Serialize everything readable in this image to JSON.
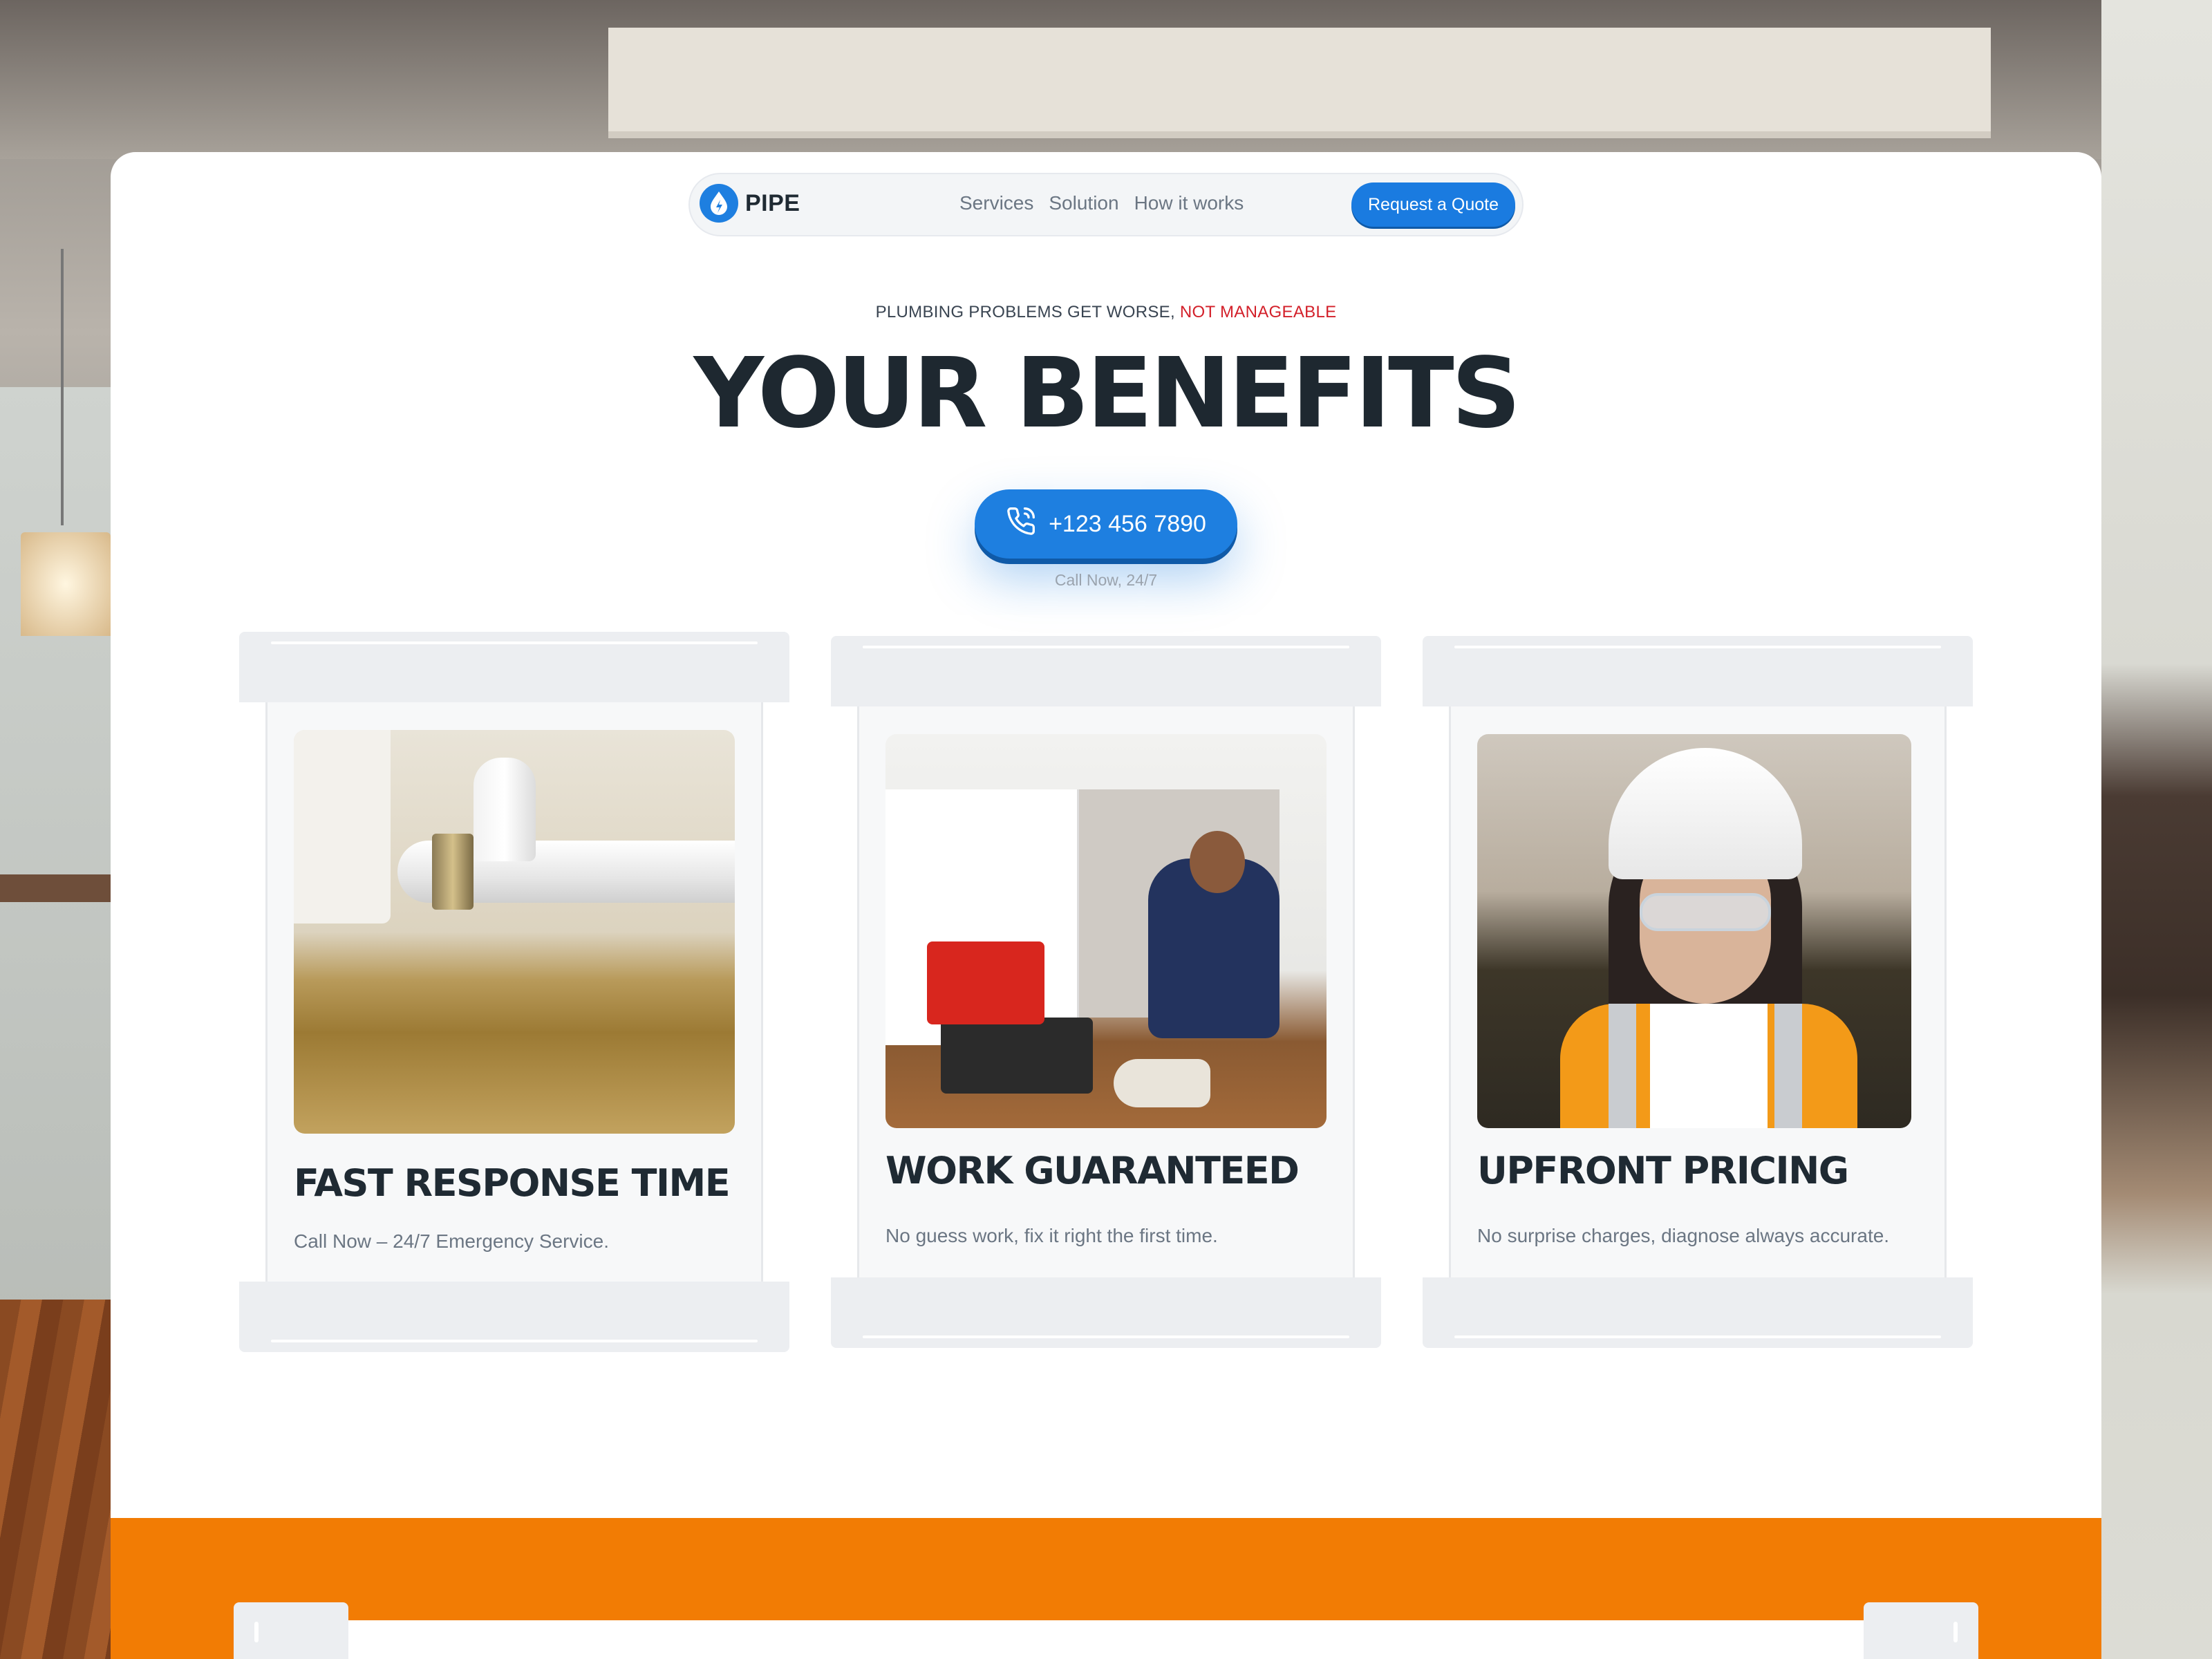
{
  "brand": {
    "name": "PIPE",
    "accent": "#1e7fe0",
    "alert": "#d3202a",
    "orange": "#f27c04"
  },
  "nav": {
    "links": [
      "Services",
      "Solution",
      "How it works"
    ],
    "cta": "Request a Quote"
  },
  "hero": {
    "eyebrow": "PLUMBING PROBLEMS GET WORSE,",
    "eyebrow_accent": "NOT MANAGEABLE",
    "title": "YOUR BENEFITS",
    "phone": "+123 456 7890",
    "call_note": "Call Now,  24/7"
  },
  "benefits": [
    {
      "title": "FAST RESPONSE TIME",
      "desc": "Call Now – 24/7 Emergency Service.",
      "image": "leaking-pipe-photo"
    },
    {
      "title": "WORK GUARANTEED",
      "desc": "No guess work, fix it right the first time.",
      "image": "plumber-under-sink-photo"
    },
    {
      "title": "UPFRONT PRICING",
      "desc": "No surprise charges, diagnose always accurate.",
      "image": "worker-hardhat-photo"
    }
  ]
}
